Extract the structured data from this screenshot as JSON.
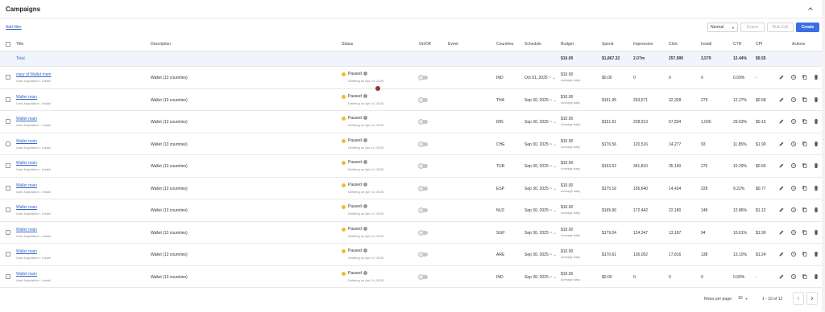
{
  "header": {
    "title": "Campaigns"
  },
  "toolbar": {
    "add_filter": "Add filter",
    "view_select": "Normal",
    "export": "Export",
    "bulk_edit": "Bulk Edit",
    "create": "Create"
  },
  "columns": {
    "title": "Title",
    "description": "Description",
    "status": "Status",
    "onoff": "On/Off",
    "event": "Event",
    "countries": "Countries",
    "schedule": "Schedule",
    "budget": "Budget",
    "spend": "Spend",
    "impression": "Impression",
    "click": "Click",
    "install": "Install",
    "ctr": "CTR",
    "cpi": "CPI",
    "actions": "Actions"
  },
  "total": {
    "label": "Total",
    "budget": "$10.00",
    "spend": "$1,867.32",
    "impression": "2.07m",
    "click": "257,990",
    "install": "3,579",
    "ctr": "12.44%",
    "cpi": "$0.55"
  },
  "rows": [
    {
      "title": "copy of Wallet main",
      "sub": "User Acquisition - Install",
      "desc": "Wallet (13 countries)",
      "status": "Paused",
      "status_sub": "Deleting on Apr 14, 2026",
      "country": "IND",
      "schedule": "Oct 01, 2025 ~",
      "budget": "$10.00",
      "budget_sub": "Average daily",
      "spend": "$0.00",
      "impression": "0",
      "click": "0",
      "install": "0",
      "ctr": "0.00%",
      "cpi": "-"
    },
    {
      "title": "Wallet main",
      "sub": "User Acquisition - Install",
      "desc": "Wallet (13 countries)",
      "status": "Paused",
      "status_sub": "Deleting on Apr 14, 2026",
      "country": "THA",
      "schedule": "Sep 30, 2025 ~",
      "budget": "$10.00",
      "budget_sub": "Average daily",
      "spend": "$161.95",
      "impression": "263,571",
      "click": "32,328",
      "install": "279",
      "ctr": "12.27%",
      "cpi": "$0.58"
    },
    {
      "title": "Wallet main",
      "sub": "User Acquisition - Install",
      "desc": "Wallet (13 countries)",
      "status": "Paused",
      "status_sub": "Deleting on Apr 14, 2026",
      "country": "IDN",
      "schedule": "Sep 30, 2025 ~",
      "budget": "$10.00",
      "budget_sub": "Average daily",
      "spend": "$151.51",
      "impression": "228,913",
      "click": "67,834",
      "install": "1,000",
      "ctr": "29.63%",
      "cpi": "$0.15"
    },
    {
      "title": "Wallet main",
      "sub": "User Acquisition - Install",
      "desc": "Wallet (13 countries)",
      "status": "Paused",
      "status_sub": "Deleting on Apr 14, 2026",
      "country": "CHE",
      "schedule": "Sep 30, 2025 ~",
      "budget": "$10.00",
      "budget_sub": "Average daily",
      "spend": "$176.56",
      "impression": "120,516",
      "click": "14,277",
      "install": "93",
      "ctr": "11.85%",
      "cpi": "$1.90"
    },
    {
      "title": "Wallet main",
      "sub": "User Acquisition - Install",
      "desc": "Wallet (13 countries)",
      "status": "Paused",
      "status_sub": "Deleting on Apr 14, 2026",
      "country": "TUR",
      "schedule": "Sep 30, 2025 ~",
      "budget": "$10.00",
      "budget_sub": "Average daily",
      "spend": "$163.52",
      "impression": "341,810",
      "click": "35,160",
      "install": "276",
      "ctr": "10.29%",
      "cpi": "$0.59"
    },
    {
      "title": "Wallet main",
      "sub": "User Acquisition - Install",
      "desc": "Wallet (13 countries)",
      "status": "Paused",
      "status_sub": "Deleting on Apr 14, 2026",
      "country": "ESP",
      "schedule": "Sep 30, 2025 ~",
      "budget": "$10.00",
      "budget_sub": "Average daily",
      "spend": "$175.16",
      "impression": "156,640",
      "click": "14,434",
      "install": "228",
      "ctr": "9.22%",
      "cpi": "$0.77"
    },
    {
      "title": "Wallet main",
      "sub": "User Acquisition - Install",
      "desc": "Wallet (13 countries)",
      "status": "Paused",
      "status_sub": "Deleting on Apr 14, 2026",
      "country": "NLD",
      "schedule": "Sep 30, 2025 ~",
      "budget": "$10.00",
      "budget_sub": "Average daily",
      "spend": "$165.90",
      "impression": "172,442",
      "click": "22,180",
      "install": "148",
      "ctr": "12.86%",
      "cpi": "$1.12"
    },
    {
      "title": "Wallet main",
      "sub": "User Acquisition - Install",
      "desc": "Wallet (13 countries)",
      "status": "Paused",
      "status_sub": "Deleting on Apr 14, 2026",
      "country": "SGP",
      "schedule": "Sep 30, 2025 ~",
      "budget": "$10.00",
      "budget_sub": "Average daily",
      "spend": "$179.04",
      "impression": "124,347",
      "click": "13,187",
      "install": "94",
      "ctr": "10.61%",
      "cpi": "$1.90"
    },
    {
      "title": "Wallet main",
      "sub": "User Acquisition - Install",
      "desc": "Wallet (13 countries)",
      "status": "Paused",
      "status_sub": "Deleting on Apr 14, 2026",
      "country": "ARE",
      "schedule": "Sep 30, 2025 ~",
      "budget": "$10.00",
      "budget_sub": "Average daily",
      "spend": "$170.61",
      "impression": "136,002",
      "click": "17,816",
      "install": "138",
      "ctr": "13.10%",
      "cpi": "$1.24"
    },
    {
      "title": "Wallet main",
      "sub": "User Acquisition - Install",
      "desc": "Wallet (13 countries)",
      "status": "Paused",
      "status_sub": "Deleting on Apr 14, 2026",
      "country": "IND",
      "schedule": "Sep 30, 2025 ~",
      "budget": "$10.00",
      "budget_sub": "Average daily",
      "spend": "$0.00",
      "impression": "0",
      "click": "0",
      "install": "0",
      "ctr": "0.00%",
      "cpi": "-"
    }
  ],
  "footer": {
    "rows_per_page_label": "Rows per page:",
    "rows_per_page": "10",
    "range": "1 - 10 of 12"
  },
  "colors": {
    "accent": "#3b6ee0",
    "link": "#3366cc",
    "paused": "#f5b82e",
    "total_bg": "#f1f5fb"
  }
}
